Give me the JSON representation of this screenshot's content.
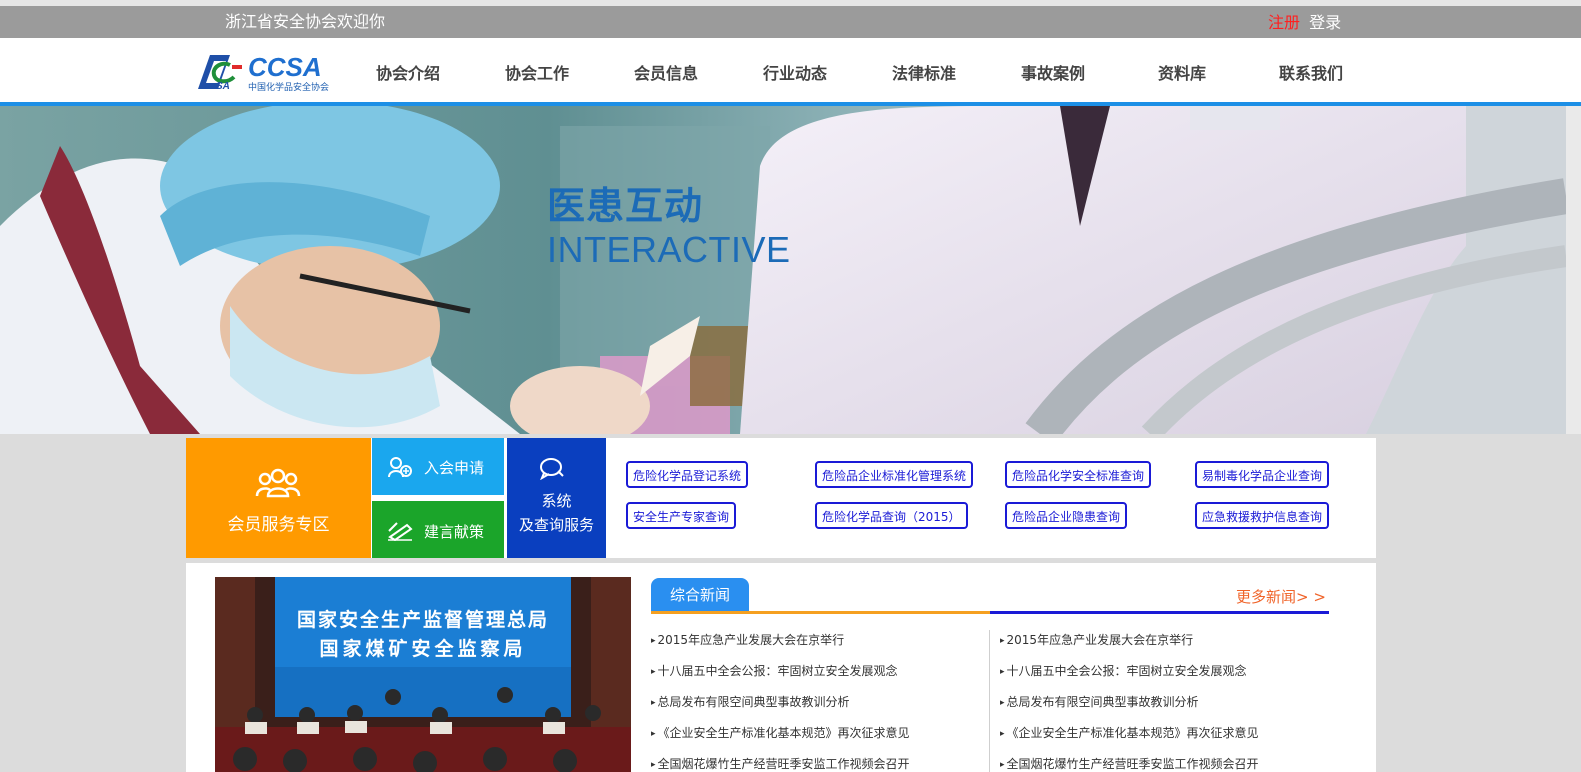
{
  "topbar": {
    "welcome": "浙江省安全协会欢迎你",
    "register": "注册",
    "login": "登录"
  },
  "logo": {
    "text": "CCSA",
    "subtitle": "中国化学品安全协会"
  },
  "nav": [
    "协会介绍",
    "协会工作",
    "会员信息",
    "行业动态",
    "法律标准",
    "事故案例",
    "资料库",
    "联系我们"
  ],
  "banner": {
    "title": "医患互动",
    "subtitle": "INTERACTIVE"
  },
  "services": {
    "member_zone": "会员服务专区",
    "join": "入会申请",
    "advice": "建言献策",
    "system_line1": "系统",
    "system_line2": "及查询服务",
    "systems": [
      "危险化学品登记系统",
      "危险品企业标准化管理系统",
      "危险品化学安全标准查询",
      "易制毒化学品企业查询",
      "安全生产专家查询",
      "危险化学品查询（2015）",
      "危险品企业隐患查询",
      "应急救援救护信息查询"
    ]
  },
  "photo": {
    "line1": "国家安全生产监督管理总局",
    "line2": "国家煤矿安全监察局"
  },
  "news": {
    "tab": "综合新闻",
    "more": "更多新闻> >",
    "left": [
      "2015年应急产业发展大会在京举行",
      "十八届五中全会公报：牢固树立安全发展观念",
      "总局发布有限空间典型事故教训分析",
      "《企业安全生产标准化基本规范》再次征求意见",
      "全国烟花爆竹生产经营旺季安监工作视频会召开"
    ],
    "right": [
      "2015年应急产业发展大会在京举行",
      "十八届五中全会公报：牢固树立安全发展观念",
      "总局发布有限空间典型事故教训分析",
      "《企业安全生产标准化基本规范》再次征求意见",
      "全国烟花爆竹生产经营旺季安监工作视频会召开"
    ]
  },
  "colors": {
    "accent_blue": "#1c8fe6",
    "orange": "#ff9a00",
    "cyan": "#1aa7ee",
    "green": "#1ba52a",
    "navy": "#0a3fbf",
    "link_blue": "#1a1ad6",
    "more_orange": "#f0642a",
    "register_red": "#ff2020"
  }
}
